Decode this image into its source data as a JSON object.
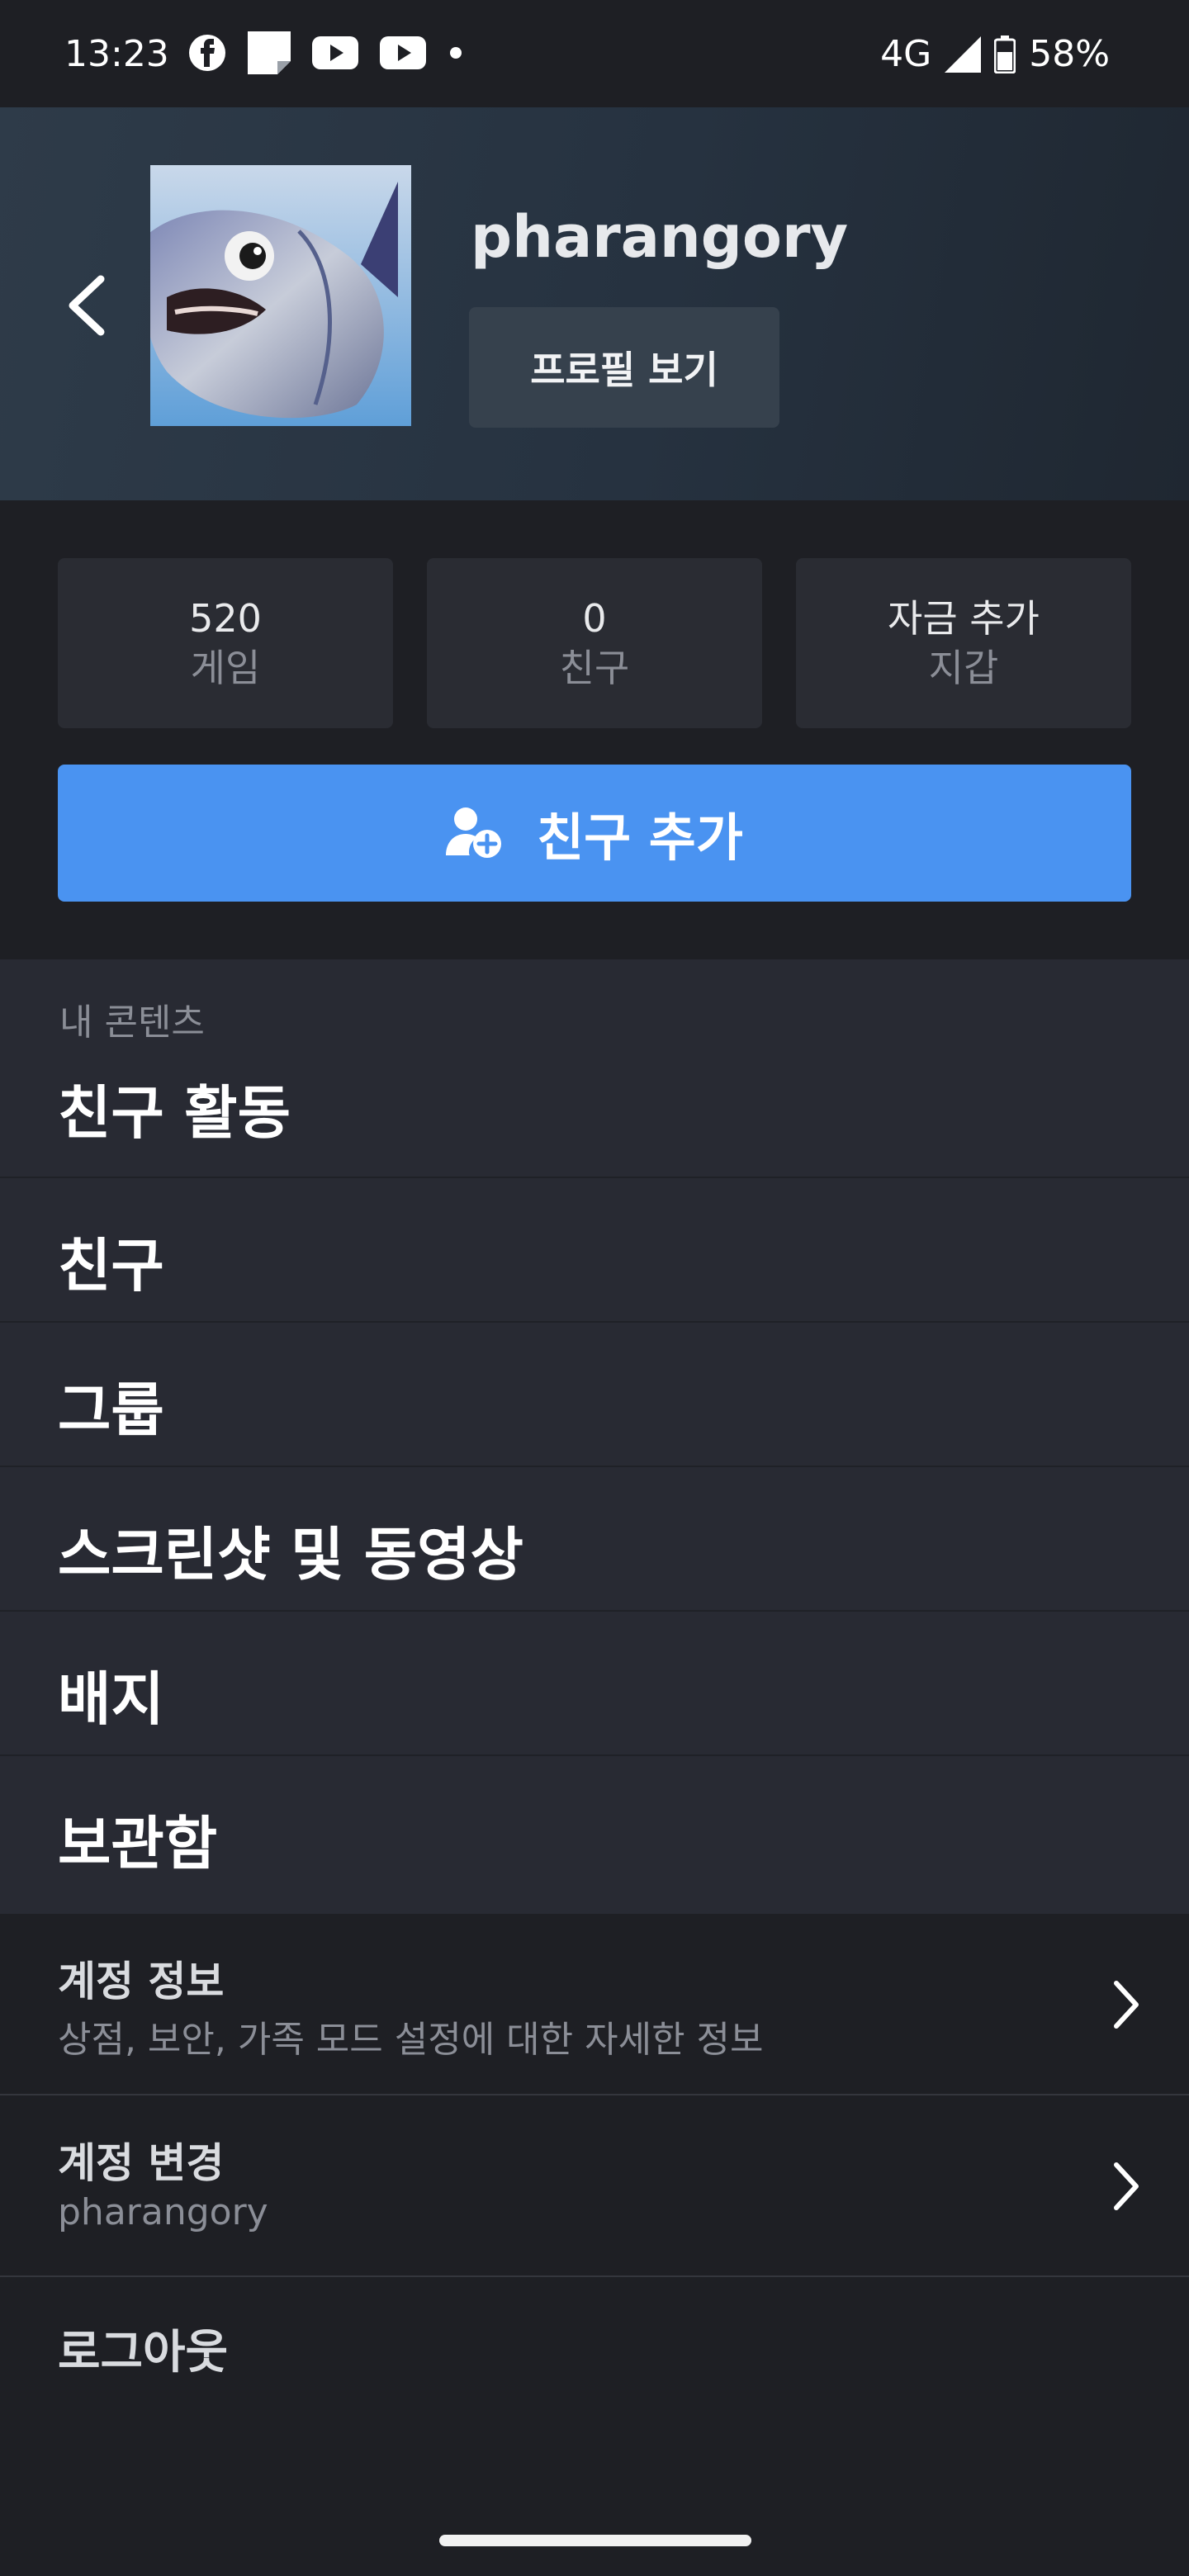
{
  "status_bar": {
    "time": "13:23",
    "network": "4G",
    "battery": "58%",
    "notification_icons": [
      "facebook-icon",
      "note-icon",
      "youtube-icon",
      "youtube-icon",
      "dot-icon"
    ]
  },
  "profile": {
    "username": "pharangory",
    "view_profile_label": "프로필 보기"
  },
  "stats": [
    {
      "value": "520",
      "label": "게임"
    },
    {
      "value": "0",
      "label": "친구"
    },
    {
      "value": "자금 추가",
      "label": "지갑"
    }
  ],
  "add_friend_label": "친구 추가",
  "content": {
    "section_label": "내 콘텐츠",
    "items": [
      "친구 활동",
      "친구",
      "그룹",
      "스크린샷 및 동영상",
      "배지",
      "보관함"
    ]
  },
  "account": {
    "info_title": "계정 정보",
    "info_subtitle": "상점, 보안, 가족 모드 설정에 대한 자세한 정보",
    "switch_title": "계정 변경",
    "switch_subtitle": "pharangory",
    "logout_label": "로그아웃"
  },
  "colors": {
    "accent": "#4a93f1",
    "background": "#1e1f24",
    "panel": "#282a33"
  }
}
